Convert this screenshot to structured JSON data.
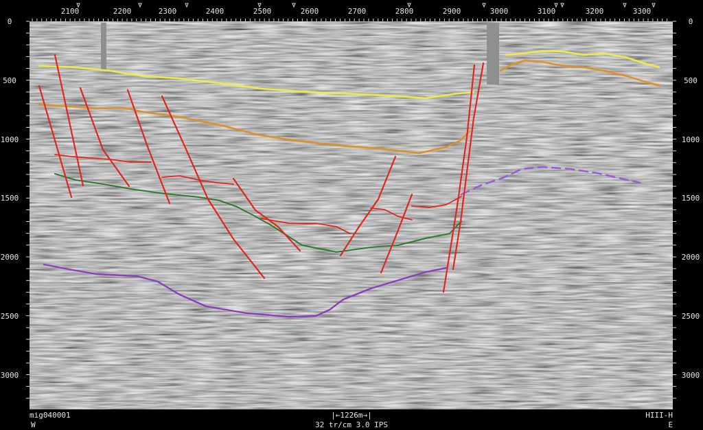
{
  "section": {
    "line_name": "mig040001",
    "scale_bar_label": "|←1226m→|",
    "display_params": "32 tr/cm 3.0 IPS",
    "survey_tag": "HIII-H",
    "west_label": "W",
    "east_label": "E",
    "cdp_labels": [
      "2100",
      "2200",
      "2300",
      "2400",
      "2500",
      "2600",
      "2700",
      "2800",
      "2900",
      "3000",
      "3100",
      "3200",
      "3300"
    ],
    "time_labels_left": [
      "0",
      "500",
      "1000",
      "1500",
      "2000",
      "2500",
      "3000"
    ],
    "time_labels_right": [
      "0",
      "500",
      "1000",
      "1500",
      "2000",
      "2500",
      "3000"
    ],
    "units_note": ""
  },
  "colors": {
    "background": "#000000",
    "horizon_yellow": "#f2e84a",
    "horizon_orange": "#e0902a",
    "horizon_green": "#2e7d2e",
    "horizon_purple": "#8a3fc0",
    "horizon_purple_dashed": "#a05ad8",
    "fault_red": "#e0261d"
  },
  "interpretation": {
    "horizons": [
      {
        "id": "yellow",
        "style": "solid"
      },
      {
        "id": "orange",
        "style": "solid"
      },
      {
        "id": "green",
        "style": "solid"
      },
      {
        "id": "purple",
        "style": "solid"
      },
      {
        "id": "purple_dashed",
        "style": "dashed"
      }
    ],
    "fault_count": 16
  }
}
